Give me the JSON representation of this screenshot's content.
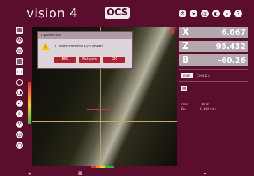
{
  "header": {
    "title": "vision 4",
    "logo": "OCS"
  },
  "top_icons": [
    "gear-icon",
    "arrow-icon",
    "target-icon",
    "mode-icon",
    "zoom-icon",
    "help-icon"
  ],
  "left_toolbar": [
    "grid-icon",
    "gear-icon",
    "target-icon",
    "grid-icon",
    "screen-icon",
    "circle-icon",
    "half-circle-icon",
    "check-icon",
    "zoom-icon",
    "pin-icon",
    "target-icon",
    "circle-icon"
  ],
  "dialog": {
    "title": "Upozornění",
    "message": "1. Nezapomeňte vynulovat!",
    "buttons": [
      "ESC",
      "Nulujem",
      "OK"
    ]
  },
  "axes": [
    {
      "name": "X",
      "value": "6.067"
    },
    {
      "name": "Z",
      "value": "95.432"
    },
    {
      "name": "B",
      "value": "-60.26"
    }
  ],
  "units": {
    "main": "mm",
    "sub": "COORD X"
  },
  "info": [
    {
      "label": "Uzol",
      "value": "90.00"
    },
    {
      "label": "Dp",
      "value": "31.324 mm"
    }
  ],
  "colors": {
    "background": "#5a0d2c",
    "accent": "#b0202e",
    "panel": "#b3a8ad"
  }
}
